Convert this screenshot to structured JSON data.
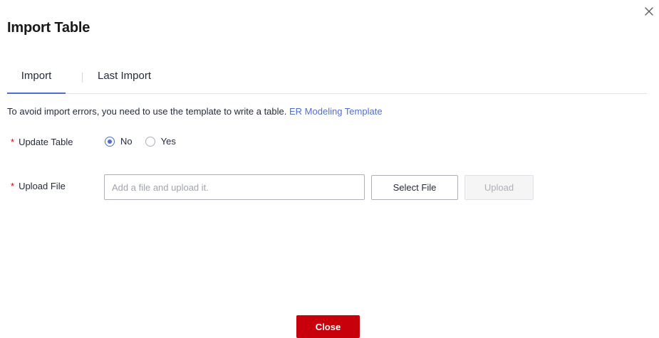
{
  "dialog": {
    "title": "Import Table",
    "close_icon": "close-icon"
  },
  "tabs": [
    {
      "label": "Import",
      "active": true
    },
    {
      "label": "Last Import",
      "active": false
    }
  ],
  "hint": {
    "text": "To avoid import errors, you need to use the template to write a table.",
    "link": "ER Modeling Template"
  },
  "update_table": {
    "required_mark": "*",
    "label": "Update Table",
    "options": [
      {
        "label": "No",
        "checked": true
      },
      {
        "label": "Yes",
        "checked": false
      }
    ]
  },
  "upload_file": {
    "required_mark": "*",
    "label": "Upload File",
    "value": "",
    "placeholder": "Add a file and upload it.",
    "select_label": "Select File",
    "upload_label": "Upload",
    "upload_disabled": true
  },
  "footer": {
    "close_label": "Close"
  },
  "colors": {
    "accent": "#526ecc",
    "danger": "#c7000b",
    "text": "#252b3a"
  }
}
